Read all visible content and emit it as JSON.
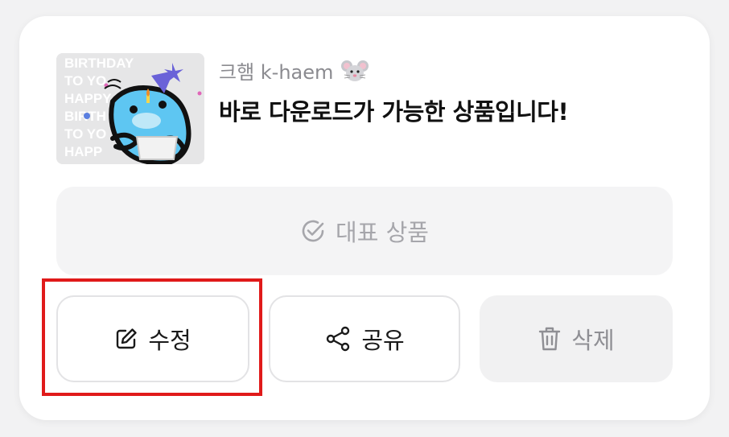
{
  "product": {
    "seller_name": "크햄 k-haem",
    "seller_emoji": "mouse-face-icon",
    "title": "바로 다운로드가 가능한 상품입니다!",
    "thumbnail_text": [
      "BIRTHDAY",
      "TO YO",
      "HAPPY",
      "BIRTH",
      "TO YO",
      "HAPP"
    ]
  },
  "featured_button": {
    "label": "대표 상품",
    "icon": "check-circle-icon"
  },
  "actions": {
    "edit_label": "수정",
    "edit_icon": "pencil-icon",
    "share_label": "공유",
    "share_icon": "share-icon",
    "delete_label": "삭제",
    "delete_icon": "trash-icon"
  },
  "colors": {
    "highlight": "#e01a1a",
    "card": "#ffffff",
    "muted_text": "#a6a6ab"
  }
}
